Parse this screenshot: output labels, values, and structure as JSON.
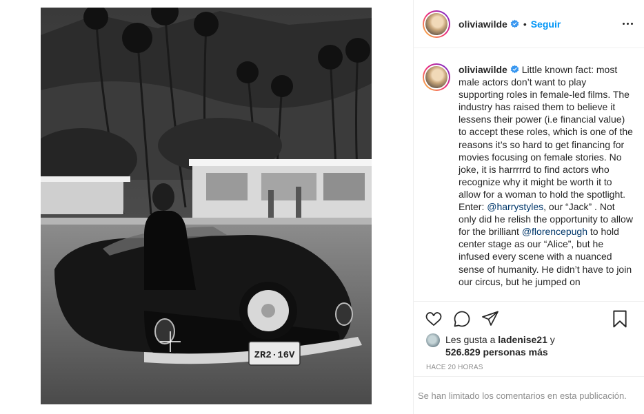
{
  "header": {
    "username": "oliviawilde",
    "dot": "•",
    "follow_label": "Seguir"
  },
  "caption": {
    "username": "oliviawilde",
    "part1": " Little known fact: most male actors don’t want to play supporting roles in female-led films. The industry has raised them to believe it lessens their power (i.e financial value) to accept these roles, which is one of the reasons it’s so hard to get financing for movies focusing on female stories. No joke, it is harrrrrd to find actors who recognize why it might be worth it to allow for a woman to hold the spotlight. Enter: ",
    "mention1": "@harrystyles",
    "part2": ", our “Jack” . Not only did he relish the opportunity to allow for the brilliant ",
    "mention2": "@florencepugh",
    "part3": " to hold center stage as our “Alice”, but he infused every scene with a nuanced sense of humanity. He didn’t have to join our circus, but he jumped on"
  },
  "likes": {
    "prefix": "Les gusta a ",
    "user": "ladenise21",
    "connector": " y",
    "count": "526.829 personas más"
  },
  "timestamp": "Hace 20 horas",
  "comments_disabled": "Se han limitado los comentarios en esta publicación.",
  "photo": {
    "plate_text": "ZR2·16V"
  },
  "colors": {
    "accent": "#0095f6",
    "mention": "#00376b",
    "muted": "#8e8e8e",
    "verified": "#3897f0"
  }
}
